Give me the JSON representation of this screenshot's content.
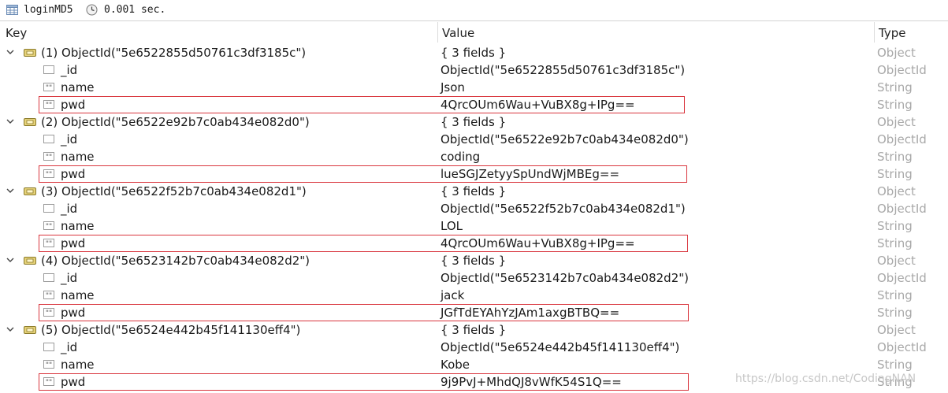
{
  "titlebar": {
    "collection": "loginMD5",
    "time": "0.001 sec."
  },
  "columns": {
    "key": "Key",
    "value": "Value",
    "type": "Type"
  },
  "documents": [
    {
      "key": "(1) ObjectId(\"5e6522855d50761c3df3185c\")",
      "value": "{ 3 fields }",
      "type": "Object",
      "fields": [
        {
          "key": "_id",
          "value": "ObjectId(\"5e6522855d50761c3df3185c\")",
          "type": "ObjectId"
        },
        {
          "key": "name",
          "value": "Json",
          "type": "String"
        },
        {
          "key": "pwd",
          "value": "4QrcOUm6Wau+VuBX8g+IPg==",
          "type": "String"
        }
      ]
    },
    {
      "key": "(2) ObjectId(\"5e6522e92b7c0ab434e082d0\")",
      "value": "{ 3 fields }",
      "type": "Object",
      "fields": [
        {
          "key": "_id",
          "value": "ObjectId(\"5e6522e92b7c0ab434e082d0\")",
          "type": "ObjectId"
        },
        {
          "key": "name",
          "value": "coding",
          "type": "String"
        },
        {
          "key": "pwd",
          "value": "lueSGJZetyySpUndWjMBEg==",
          "type": "String"
        }
      ]
    },
    {
      "key": "(3) ObjectId(\"5e6522f52b7c0ab434e082d1\")",
      "value": "{ 3 fields }",
      "type": "Object",
      "fields": [
        {
          "key": "_id",
          "value": "ObjectId(\"5e6522f52b7c0ab434e082d1\")",
          "type": "ObjectId"
        },
        {
          "key": "name",
          "value": "LOL",
          "type": "String"
        },
        {
          "key": "pwd",
          "value": "4QrcOUm6Wau+VuBX8g+IPg==",
          "type": "String"
        }
      ]
    },
    {
      "key": "(4) ObjectId(\"5e6523142b7c0ab434e082d2\")",
      "value": "{ 3 fields }",
      "type": "Object",
      "fields": [
        {
          "key": "_id",
          "value": "ObjectId(\"5e6523142b7c0ab434e082d2\")",
          "type": "ObjectId"
        },
        {
          "key": "name",
          "value": "jack",
          "type": "String"
        },
        {
          "key": "pwd",
          "value": "JGfTdEYAhYzJAm1axgBTBQ==",
          "type": "String"
        }
      ]
    },
    {
      "key": "(5) ObjectId(\"5e6524e442b45f141130eff4\")",
      "value": "{ 3 fields }",
      "type": "Object",
      "fields": [
        {
          "key": "_id",
          "value": "ObjectId(\"5e6524e442b45f141130eff4\")",
          "type": "ObjectId"
        },
        {
          "key": "name",
          "value": "Kobe",
          "type": "String"
        },
        {
          "key": "pwd",
          "value": "9j9PvJ+MhdQJ8vWfK54S1Q==",
          "type": "String"
        }
      ]
    }
  ],
  "watermark": "https://blog.csdn.net/CodingNAN",
  "colors": {
    "highlight": "#d9363e",
    "type_text": "#a8a8a8",
    "doc_icon": "#c8b24a"
  }
}
